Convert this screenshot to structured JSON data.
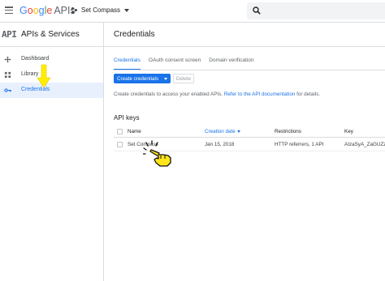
{
  "topbar": {
    "logo_google": [
      "G",
      "o",
      "o",
      "g",
      "l",
      "e"
    ],
    "logo_product": "APIs",
    "project_name": "Set Compass"
  },
  "sidebar": {
    "api_mark": "API",
    "title": "APIs & Services",
    "items": [
      {
        "label": "Dashboard",
        "icon": "dashboard-icon",
        "active": false
      },
      {
        "label": "Library",
        "icon": "library-icon",
        "active": false
      },
      {
        "label": "Credentials",
        "icon": "key-icon",
        "active": true
      }
    ]
  },
  "main": {
    "title": "Credentials",
    "tabs": [
      {
        "label": "Credentials",
        "active": true
      },
      {
        "label": "OAuth consent screen",
        "active": false
      },
      {
        "label": "Domain verification",
        "active": false
      }
    ],
    "create_button": "Create credentials",
    "delete_button": "Delete",
    "info_text": "Create credentials to access your enabled APIs.",
    "info_link": "Refer to the API documentation",
    "info_suffix": "for details.",
    "section_title": "API keys",
    "table": {
      "columns": [
        "Name",
        "Creation date",
        "Restrictions",
        "Key"
      ],
      "sorted_column": "Creation date",
      "rows": [
        {
          "name": "Set Compass",
          "date": "Jan 15, 2018",
          "restrictions": "HTTP referrers, 1 API",
          "key": "AIzaSyA_ZaGUZz"
        }
      ]
    }
  },
  "colors": {
    "accent": "#1a73e8",
    "active_bg": "#e8f0fe",
    "highlight": "#ffee00"
  }
}
